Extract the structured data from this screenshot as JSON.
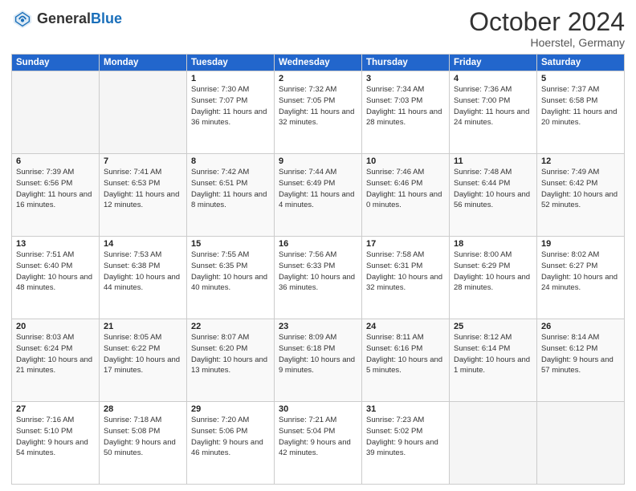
{
  "header": {
    "logo_general": "General",
    "logo_blue": "Blue",
    "month_title": "October 2024",
    "location": "Hoerstel, Germany"
  },
  "days_of_week": [
    "Sunday",
    "Monday",
    "Tuesday",
    "Wednesday",
    "Thursday",
    "Friday",
    "Saturday"
  ],
  "weeks": [
    {
      "cells": [
        {
          "day": "",
          "empty": true
        },
        {
          "day": "",
          "empty": true
        },
        {
          "day": "1",
          "sunrise": "Sunrise: 7:30 AM",
          "sunset": "Sunset: 7:07 PM",
          "daylight": "Daylight: 11 hours and 36 minutes."
        },
        {
          "day": "2",
          "sunrise": "Sunrise: 7:32 AM",
          "sunset": "Sunset: 7:05 PM",
          "daylight": "Daylight: 11 hours and 32 minutes."
        },
        {
          "day": "3",
          "sunrise": "Sunrise: 7:34 AM",
          "sunset": "Sunset: 7:03 PM",
          "daylight": "Daylight: 11 hours and 28 minutes."
        },
        {
          "day": "4",
          "sunrise": "Sunrise: 7:36 AM",
          "sunset": "Sunset: 7:00 PM",
          "daylight": "Daylight: 11 hours and 24 minutes."
        },
        {
          "day": "5",
          "sunrise": "Sunrise: 7:37 AM",
          "sunset": "Sunset: 6:58 PM",
          "daylight": "Daylight: 11 hours and 20 minutes."
        }
      ]
    },
    {
      "cells": [
        {
          "day": "6",
          "sunrise": "Sunrise: 7:39 AM",
          "sunset": "Sunset: 6:56 PM",
          "daylight": "Daylight: 11 hours and 16 minutes."
        },
        {
          "day": "7",
          "sunrise": "Sunrise: 7:41 AM",
          "sunset": "Sunset: 6:53 PM",
          "daylight": "Daylight: 11 hours and 12 minutes."
        },
        {
          "day": "8",
          "sunrise": "Sunrise: 7:42 AM",
          "sunset": "Sunset: 6:51 PM",
          "daylight": "Daylight: 11 hours and 8 minutes."
        },
        {
          "day": "9",
          "sunrise": "Sunrise: 7:44 AM",
          "sunset": "Sunset: 6:49 PM",
          "daylight": "Daylight: 11 hours and 4 minutes."
        },
        {
          "day": "10",
          "sunrise": "Sunrise: 7:46 AM",
          "sunset": "Sunset: 6:46 PM",
          "daylight": "Daylight: 11 hours and 0 minutes."
        },
        {
          "day": "11",
          "sunrise": "Sunrise: 7:48 AM",
          "sunset": "Sunset: 6:44 PM",
          "daylight": "Daylight: 10 hours and 56 minutes."
        },
        {
          "day": "12",
          "sunrise": "Sunrise: 7:49 AM",
          "sunset": "Sunset: 6:42 PM",
          "daylight": "Daylight: 10 hours and 52 minutes."
        }
      ]
    },
    {
      "cells": [
        {
          "day": "13",
          "sunrise": "Sunrise: 7:51 AM",
          "sunset": "Sunset: 6:40 PM",
          "daylight": "Daylight: 10 hours and 48 minutes."
        },
        {
          "day": "14",
          "sunrise": "Sunrise: 7:53 AM",
          "sunset": "Sunset: 6:38 PM",
          "daylight": "Daylight: 10 hours and 44 minutes."
        },
        {
          "day": "15",
          "sunrise": "Sunrise: 7:55 AM",
          "sunset": "Sunset: 6:35 PM",
          "daylight": "Daylight: 10 hours and 40 minutes."
        },
        {
          "day": "16",
          "sunrise": "Sunrise: 7:56 AM",
          "sunset": "Sunset: 6:33 PM",
          "daylight": "Daylight: 10 hours and 36 minutes."
        },
        {
          "day": "17",
          "sunrise": "Sunrise: 7:58 AM",
          "sunset": "Sunset: 6:31 PM",
          "daylight": "Daylight: 10 hours and 32 minutes."
        },
        {
          "day": "18",
          "sunrise": "Sunrise: 8:00 AM",
          "sunset": "Sunset: 6:29 PM",
          "daylight": "Daylight: 10 hours and 28 minutes."
        },
        {
          "day": "19",
          "sunrise": "Sunrise: 8:02 AM",
          "sunset": "Sunset: 6:27 PM",
          "daylight": "Daylight: 10 hours and 24 minutes."
        }
      ]
    },
    {
      "cells": [
        {
          "day": "20",
          "sunrise": "Sunrise: 8:03 AM",
          "sunset": "Sunset: 6:24 PM",
          "daylight": "Daylight: 10 hours and 21 minutes."
        },
        {
          "day": "21",
          "sunrise": "Sunrise: 8:05 AM",
          "sunset": "Sunset: 6:22 PM",
          "daylight": "Daylight: 10 hours and 17 minutes."
        },
        {
          "day": "22",
          "sunrise": "Sunrise: 8:07 AM",
          "sunset": "Sunset: 6:20 PM",
          "daylight": "Daylight: 10 hours and 13 minutes."
        },
        {
          "day": "23",
          "sunrise": "Sunrise: 8:09 AM",
          "sunset": "Sunset: 6:18 PM",
          "daylight": "Daylight: 10 hours and 9 minutes."
        },
        {
          "day": "24",
          "sunrise": "Sunrise: 8:11 AM",
          "sunset": "Sunset: 6:16 PM",
          "daylight": "Daylight: 10 hours and 5 minutes."
        },
        {
          "day": "25",
          "sunrise": "Sunrise: 8:12 AM",
          "sunset": "Sunset: 6:14 PM",
          "daylight": "Daylight: 10 hours and 1 minute."
        },
        {
          "day": "26",
          "sunrise": "Sunrise: 8:14 AM",
          "sunset": "Sunset: 6:12 PM",
          "daylight": "Daylight: 9 hours and 57 minutes."
        }
      ]
    },
    {
      "cells": [
        {
          "day": "27",
          "sunrise": "Sunrise: 7:16 AM",
          "sunset": "Sunset: 5:10 PM",
          "daylight": "Daylight: 9 hours and 54 minutes."
        },
        {
          "day": "28",
          "sunrise": "Sunrise: 7:18 AM",
          "sunset": "Sunset: 5:08 PM",
          "daylight": "Daylight: 9 hours and 50 minutes."
        },
        {
          "day": "29",
          "sunrise": "Sunrise: 7:20 AM",
          "sunset": "Sunset: 5:06 PM",
          "daylight": "Daylight: 9 hours and 46 minutes."
        },
        {
          "day": "30",
          "sunrise": "Sunrise: 7:21 AM",
          "sunset": "Sunset: 5:04 PM",
          "daylight": "Daylight: 9 hours and 42 minutes."
        },
        {
          "day": "31",
          "sunrise": "Sunrise: 7:23 AM",
          "sunset": "Sunset: 5:02 PM",
          "daylight": "Daylight: 9 hours and 39 minutes."
        },
        {
          "day": "",
          "empty": true
        },
        {
          "day": "",
          "empty": true
        }
      ]
    }
  ]
}
